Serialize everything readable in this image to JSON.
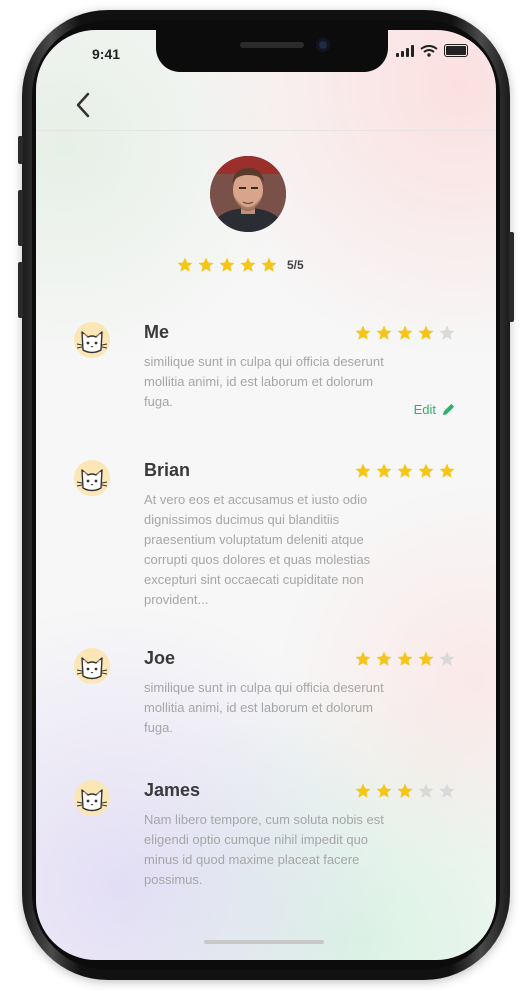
{
  "status": {
    "time": "9:41"
  },
  "profile": {
    "rating_text": "5/5",
    "stars": 5
  },
  "reviews": [
    {
      "name": "Me",
      "stars": 4,
      "text": "similique sunt in culpa qui officia deserunt mollitia animi, id est laborum et dolorum fuga.",
      "action": "Edit"
    },
    {
      "name": "Brian",
      "stars": 5,
      "text": "At vero eos et accusamus et iusto odio dignissimos ducimus qui blanditiis praesentium voluptatum deleniti atque corrupti quos dolores et quas molestias excepturi sint occaecati cupiditate non provident..."
    },
    {
      "name": "Joe",
      "stars": 4,
      "text": "similique sunt in culpa qui officia deserunt mollitia animi, id est laborum et dolorum fuga."
    },
    {
      "name": "James",
      "stars": 3,
      "text": "Nam libero tempore, cum soluta nobis est eligendi optio cumque nihil impedit quo minus id quod maxime placeat facere possimus."
    }
  ],
  "colors": {
    "star_filled": "#f5c518",
    "star_empty": "#d9d9d9",
    "edit": "#2db26b"
  },
  "icons": [
    "back-chevron-icon",
    "star-icon",
    "pencil-icon",
    "cat-avatar-icon",
    "signal-icon",
    "wifi-icon",
    "battery-icon"
  ]
}
